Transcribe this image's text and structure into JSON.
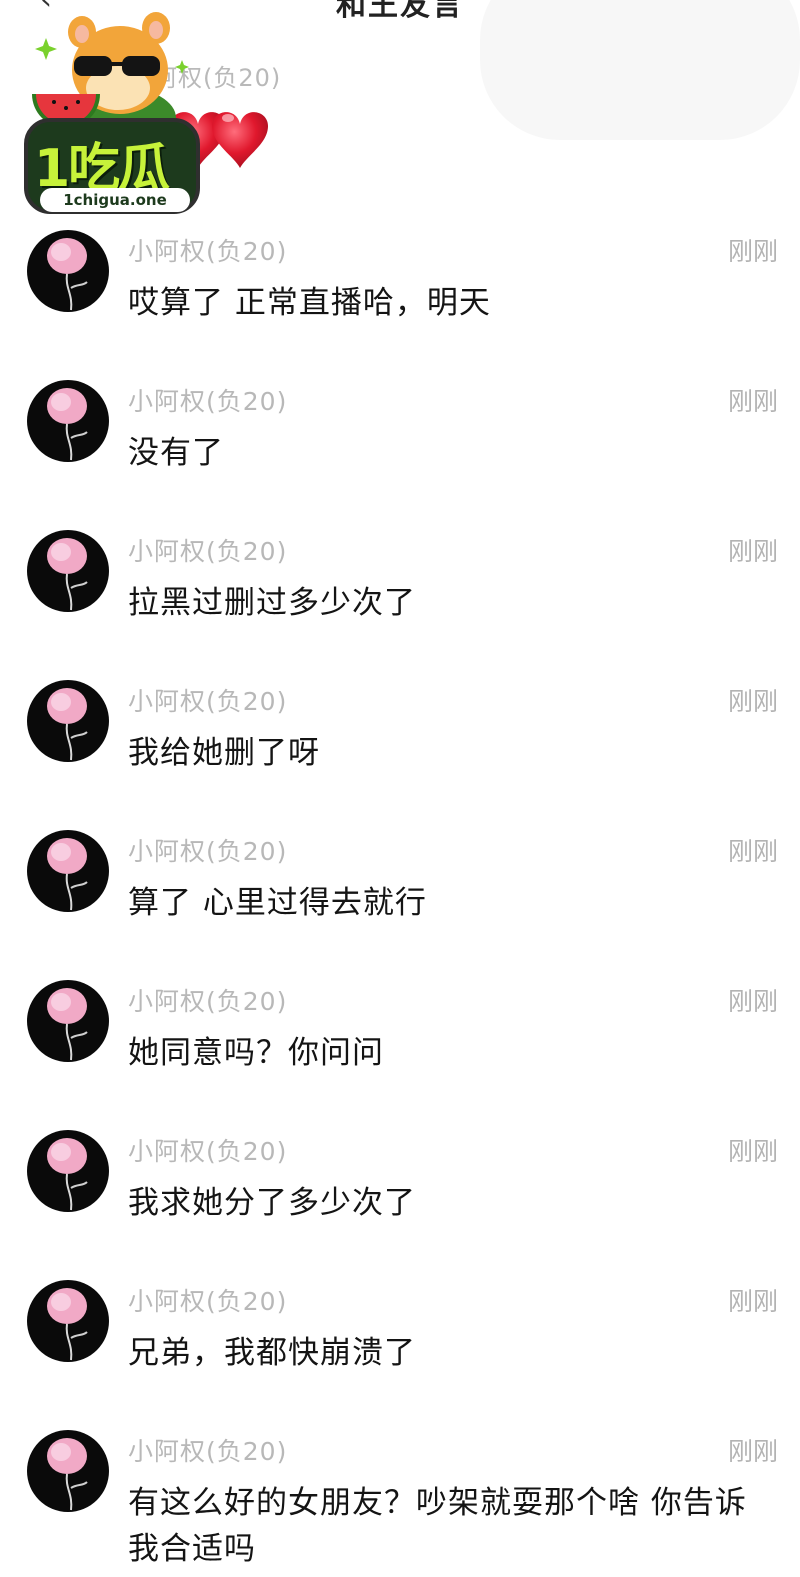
{
  "header": {
    "back_icon": "chevron-left-icon",
    "title": "和王友言"
  },
  "watermark": {
    "logo": "1吃瓜",
    "domain": "1chigua.one"
  },
  "partial_message": {
    "sender": "小阿权(负20)"
  },
  "messages": [
    {
      "sender": "小阿权(负20)",
      "time": "刚刚",
      "text": "哎算了 正常直播哈，明天"
    },
    {
      "sender": "小阿权(负20)",
      "time": "刚刚",
      "text": "没有了"
    },
    {
      "sender": "小阿权(负20)",
      "time": "刚刚",
      "text": "拉黑过删过多少次了"
    },
    {
      "sender": "小阿权(负20)",
      "time": "刚刚",
      "text": "我给她删了呀"
    },
    {
      "sender": "小阿权(负20)",
      "time": "刚刚",
      "text": "算了 心里过得去就行"
    },
    {
      "sender": "小阿权(负20)",
      "time": "刚刚",
      "text": "她同意吗？你问问"
    },
    {
      "sender": "小阿权(负20)",
      "time": "刚刚",
      "text": "我求她分了多少次了"
    },
    {
      "sender": "小阿权(负20)",
      "time": "刚刚",
      "text": "兄弟，我都快崩溃了"
    },
    {
      "sender": "小阿权(负20)",
      "time": "刚刚",
      "text": "有这么好的女朋友？吵架就耍那个啥 你告诉我合适吗"
    }
  ],
  "colors": {
    "background": "#ffffff",
    "sender": "#b8b8b8",
    "text": "#141414",
    "heart": "#e0182d"
  }
}
